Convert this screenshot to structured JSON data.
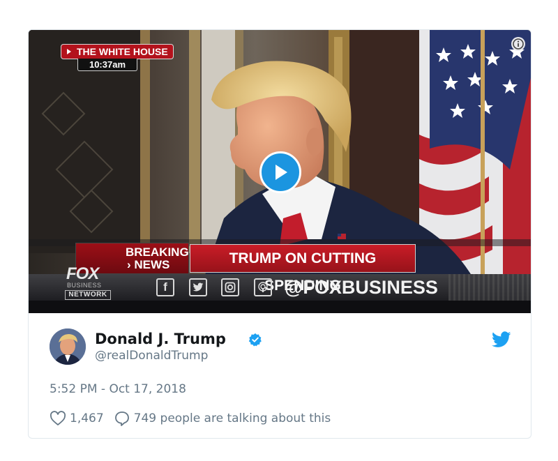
{
  "video": {
    "location_tag": "THE WHITE HOUSE",
    "time_tag": "10:37am",
    "breaking_line1": "BREAKING",
    "breaking_line2": "› NEWS",
    "headline": "TRUMP ON CUTTING SPENDING",
    "network_logo": "FOX",
    "network_sub": "BUSINESS",
    "network_box": "NETWORK",
    "social_handle": "@FOXBUSINESS",
    "social_icons": [
      "facebook-icon",
      "twitter-icon",
      "instagram-icon",
      "podcast-icon"
    ]
  },
  "tweet": {
    "display_name": "Donald J. Trump",
    "screen_name": "@realDonaldTrump",
    "timestamp": "5:52 PM - Oct 17, 2018",
    "like_count": "1,467",
    "talking_text": "749 people are talking about this"
  },
  "colors": {
    "twitter_blue": "#1da1f2",
    "play_blue": "#1b95e0",
    "breaking_red": "#c91d27",
    "muted_text": "#657786"
  }
}
